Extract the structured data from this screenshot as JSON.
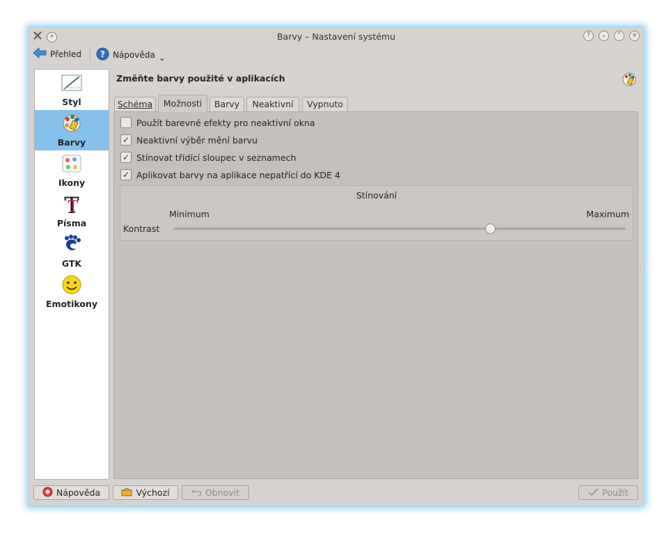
{
  "window": {
    "title": "Barvy – Nastavení systému"
  },
  "toolbar": {
    "overview_label": "Přehled",
    "help_label": "Nápověda",
    "help_dropdown": "⌄"
  },
  "sidebar": {
    "items": [
      {
        "label": "Styl",
        "icon": "style-icon",
        "selected": false
      },
      {
        "label": "Barvy",
        "icon": "colors-icon",
        "selected": true
      },
      {
        "label": "Ikony",
        "icon": "icons-icon",
        "selected": false
      },
      {
        "label": "Písma",
        "icon": "fonts-icon",
        "selected": false
      },
      {
        "label": "GTK",
        "icon": "gtk-icon",
        "selected": false
      },
      {
        "label": "Emotikony",
        "icon": "emoticons-icon",
        "selected": false
      }
    ]
  },
  "main": {
    "heading": "Změňte barvy použité v aplikacích",
    "tabs": [
      {
        "label": "Schéma",
        "active": false
      },
      {
        "label": "Možnosti",
        "active": true
      },
      {
        "label": "Barvy",
        "active": false
      },
      {
        "label": "Neaktivní",
        "active": false
      },
      {
        "label": "Vypnuto",
        "active": false
      }
    ],
    "options": [
      {
        "label": "Použít barevné efekty pro neaktivní okna",
        "checked": false
      },
      {
        "label": "Neaktivní výběr mění barvu",
        "checked": true
      },
      {
        "label": "Stínovat třídící sloupec v seznamech",
        "checked": true
      },
      {
        "label": "Aplikovat barvy na aplikace nepatřící do KDE 4",
        "checked": true
      }
    ],
    "shading": {
      "title": "Stínování",
      "min_label": "Minimum",
      "max_label": "Maximum",
      "contrast_label": "Kontrast",
      "contrast_value_fraction": 0.7
    }
  },
  "buttons": {
    "help": "Nápověda",
    "defaults": "Výchozí",
    "reset": "Obnovit",
    "apply": "Použít"
  },
  "colors": {
    "selection": "#86c1eb",
    "window_glow": "#50afeb"
  }
}
